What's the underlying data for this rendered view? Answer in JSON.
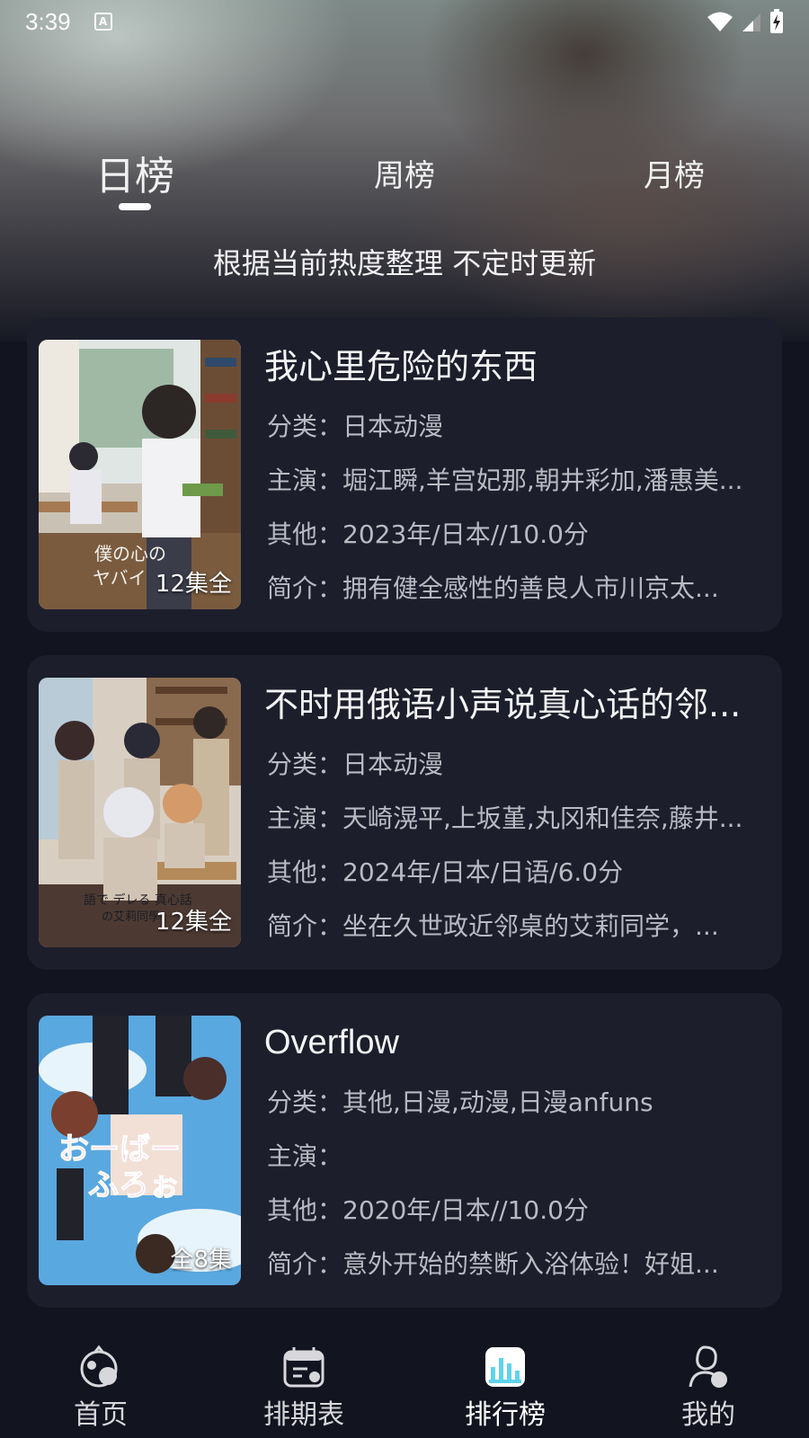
{
  "status_bar": {
    "time": "3:39",
    "notification_icon": "A",
    "icons": [
      "wifi-icon",
      "signal-icon",
      "battery-icon"
    ]
  },
  "tabs": [
    {
      "label": "日榜",
      "active": true
    },
    {
      "label": "周榜",
      "active": false
    },
    {
      "label": "月榜",
      "active": false
    }
  ],
  "subtitle": "根据当前热度整理 不定时更新",
  "items": [
    {
      "title": "我心里危险的东西",
      "category_label": "分类：",
      "category": "日本动漫",
      "cast_label": "主演：",
      "cast": "堀江瞬,羊宫妃那,朝井彩加,潘惠美...",
      "other_label": "其他：",
      "other": "2023年/日本//10.0分",
      "summary_label": "简介：",
      "summary": "拥有健全感性的善良人市川京太...",
      "episodes": "12集全",
      "poster_text": "僕の心の ヤバイやつ"
    },
    {
      "title": "不时用俄语小声说真心话的邻...",
      "category_label": "分类：",
      "category": "日本动漫",
      "cast_label": "主演：",
      "cast": "天崎滉平,上坂堇,丸冈和佳奈,藤井...",
      "other_label": "其他：",
      "other": "2024年/日本/日语/6.0分",
      "summary_label": "简介：",
      "summary": "坐在久世政近邻桌的艾莉同学，...",
      "episodes": "12集全",
      "poster_text": "語で デレる 真心話 の艾莉同學"
    },
    {
      "title": "Overflow",
      "category_label": "分类：",
      "category": "其他,日漫,动漫,日漫anfuns",
      "cast_label": "主演：",
      "cast": "",
      "other_label": "其他：",
      "other": "2020年/日本//10.0分",
      "summary_label": "简介：",
      "summary": "意外开始的禁断入浴体验！好姐...",
      "episodes": "全8集",
      "poster_text": "おーばー ふろぉ"
    }
  ],
  "nav": [
    {
      "label": "首页",
      "icon": "home-icon",
      "active": false
    },
    {
      "label": "排期表",
      "icon": "calendar-icon",
      "active": false
    },
    {
      "label": "排行榜",
      "icon": "ranking-icon",
      "active": true
    },
    {
      "label": "我的",
      "icon": "profile-icon",
      "active": false
    }
  ],
  "colors": {
    "background": "#121420",
    "card": "#1c1e2b",
    "accent": "#5fd3ea",
    "text_primary": "#f4f4f6",
    "text_secondary": "#b9bac3"
  }
}
